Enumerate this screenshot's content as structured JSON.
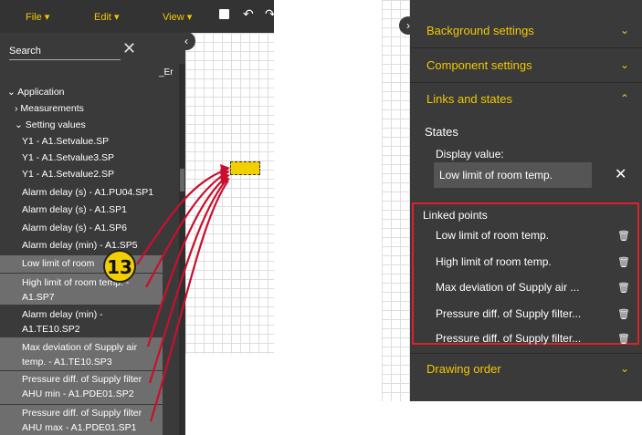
{
  "menu": {
    "file": "File ▾",
    "edit": "Edit ▾",
    "view": "View ▾"
  },
  "search": {
    "label": "Search",
    "clip_text": "_Er"
  },
  "tree": {
    "application": "Application",
    "measurements": "Measurements",
    "setting_values": "Setting values",
    "items": [
      "Y1 - A1.Setvalue.SP",
      "Y1 - A1.Setvalue3.SP",
      "Y1 - A1.Setvalue2.SP",
      "Alarm delay (s) - A1.PU04.SP1",
      "Alarm delay (s) - A1.SP1",
      "Alarm delay (s) - A1.SP6",
      "Alarm delay (min) - A1.SP5",
      "Low limit of room",
      "High limit of room temp. -",
      "A1.SP7",
      "Alarm delay (min) -",
      "A1.TE10.SP2",
      "Max deviation of Supply air",
      "temp. - A1.TE10.SP3",
      "Pressure diff. of Supply filter",
      "AHU min - A1.PDE01.SP2",
      "Pressure diff. of Supply filter",
      "AHU max - A1.PDE01.SP1"
    ]
  },
  "badge": "13",
  "right": {
    "sections": {
      "background": "Background settings",
      "component": "Component settings",
      "links": "Links and states",
      "drawing": "Drawing order"
    },
    "states_title": "States",
    "display_label": "Display value:",
    "display_value": "Low limit of room temp.",
    "linked_title": "Linked points",
    "linked_points": [
      "Low limit of room temp.",
      "High limit of room temp.",
      "Max deviation of Supply air ...",
      "Pressure diff. of Supply filter...",
      "Pressure diff. of Supply filter..."
    ]
  },
  "colors": {
    "accent": "#f2c800",
    "highlight_box": "#d9222a",
    "panel": "#3a3a3a"
  }
}
